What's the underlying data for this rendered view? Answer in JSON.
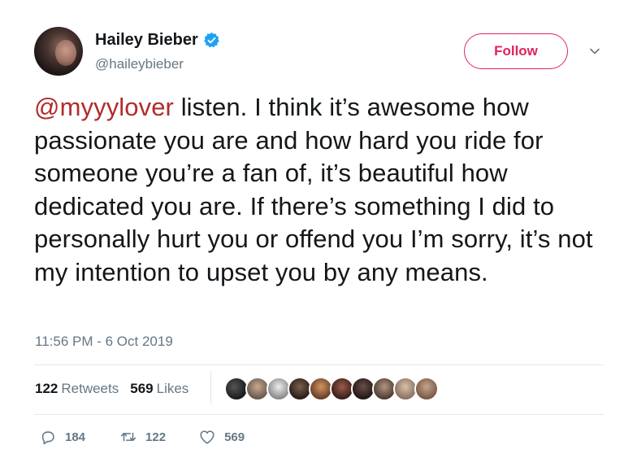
{
  "author": {
    "name": "Hailey Bieber",
    "handle": "@haileybieber",
    "verified_icon": "verified-badge-icon",
    "avatar_icon": "profile-avatar"
  },
  "follow_label": "Follow",
  "tweet": {
    "mention": "@myyylover",
    "body": " listen. I think it’s awesome how passionate you are and how hard you ride for someone you’re a fan of, it’s beautiful how dedicated you are. If there’s something I did to personally hurt you or offend you I’m sorry, it’s not my intention to upset you by any means."
  },
  "timestamp": "11:56 PM - 6 Oct 2019",
  "stats": {
    "retweets_count": "122",
    "retweets_label": "Retweets",
    "likes_count": "569",
    "likes_label": "Likes"
  },
  "likers_count_shown": 10,
  "actions": {
    "reply_count": "184",
    "retweet_count": "122",
    "like_count": "569"
  },
  "colors": {
    "accent": "#e0245e",
    "mention": "#b22b2b",
    "verified": "#1da1f2",
    "muted": "#657786"
  }
}
